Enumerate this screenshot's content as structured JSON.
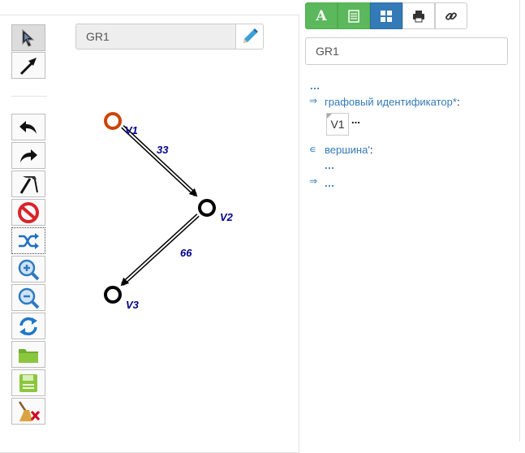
{
  "editor": {
    "graph_name": "GR1",
    "vertices": [
      {
        "id": "V1",
        "color": "#cc4400"
      },
      {
        "id": "V2",
        "color": "#000000"
      },
      {
        "id": "V3",
        "color": "#000000"
      }
    ],
    "edges": [
      {
        "from": "V1",
        "to": "V2",
        "weight": "33"
      },
      {
        "from": "V2",
        "to": "V3",
        "weight": "66"
      }
    ]
  },
  "toolbar": {
    "tools": [
      "select-tool",
      "draw-arc-tool",
      "undo",
      "redo",
      "hammer-tool",
      "delete",
      "change-arc-type",
      "zoom-in",
      "zoom-out",
      "refresh",
      "open-folder",
      "save",
      "clear"
    ]
  },
  "right": {
    "tabs": [
      {
        "label": "A",
        "icon": "letter-a-icon",
        "style": "green"
      },
      {
        "label": "",
        "icon": "list-icon",
        "style": "green"
      },
      {
        "label": "",
        "icon": "grid-icon",
        "style": "blue"
      },
      {
        "label": "",
        "icon": "print-icon",
        "style": "white"
      },
      {
        "label": "",
        "icon": "link-icon",
        "style": "white"
      }
    ],
    "identifier": "GR1",
    "scn": {
      "top_dots": "...",
      "rel1_mark": "⇒",
      "rel1_label": "графовый идентификатор*",
      "rel1_colon": ":",
      "node_label": "V1",
      "node_dots": "...",
      "rel2_mark": "∊",
      "rel2_label": "вершина'",
      "rel2_colon": ":",
      "rel2_dots": "...",
      "rel3_mark": "⇒",
      "rel3_dots": "..."
    }
  },
  "colors": {
    "green": "#5cb85c",
    "blue": "#337ab7",
    "link": "#337ab7",
    "label": "#00008b",
    "start_vertex": "#cc4400"
  }
}
